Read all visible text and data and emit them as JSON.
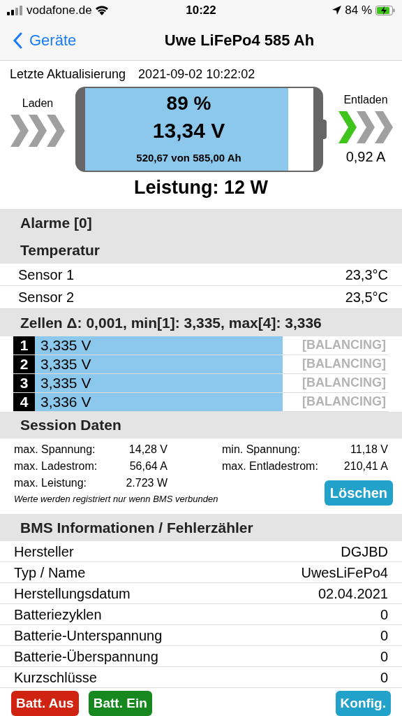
{
  "status_bar": {
    "carrier": "vodafone.de",
    "time": "10:22",
    "battery": "84 %"
  },
  "nav": {
    "back": "Geräte",
    "title": "Uwe LiFePo4 585 Ah"
  },
  "update": {
    "label": "Letzte Aktualisierung",
    "value": "2021-09-02 10:22:02"
  },
  "battery": {
    "percent": "89 %",
    "voltage": "13,34 V",
    "capacity": "520,67 von 585,00 Ah",
    "level": 0.89,
    "power": "Leistung: 12 W",
    "charge": {
      "label": "Laden",
      "arrows": [
        {
          "on": false
        },
        {
          "on": false
        },
        {
          "on": false
        }
      ]
    },
    "discharge": {
      "label": "Entladen",
      "current": "0,92 A",
      "arrows": [
        {
          "on": true
        },
        {
          "on": false
        },
        {
          "on": false
        }
      ]
    }
  },
  "alarms": {
    "title": "Alarme [0]"
  },
  "temperature": {
    "title": "Temperatur",
    "sensors": [
      {
        "name": "Sensor 1",
        "value": "23,3°C"
      },
      {
        "name": "Sensor 2",
        "value": "23,5°C"
      }
    ]
  },
  "cells": {
    "title": "Zellen Δ: 0,001, min[1]: 3,335, max[4]: 3,336",
    "items": [
      {
        "index": "1",
        "voltage": "3,335 V",
        "balancing": false,
        "status": "[BALANCING]"
      },
      {
        "index": "2",
        "voltage": "3,335 V",
        "balancing": false,
        "status": "[BALANCING]"
      },
      {
        "index": "3",
        "voltage": "3,335 V",
        "balancing": false,
        "status": "[BALANCING]"
      },
      {
        "index": "4",
        "voltage": "3,336 V",
        "balancing": false,
        "status": "[BALANCING]"
      }
    ]
  },
  "session": {
    "title": "Session Daten",
    "left": [
      {
        "label": "max. Spannung:",
        "value": "14,28 V"
      },
      {
        "label": "max. Ladestrom:",
        "value": "56,64 A"
      },
      {
        "label": "max. Leistung:",
        "value": "2.723 W"
      }
    ],
    "right": [
      {
        "label": "min. Spannung:",
        "value": "11,18 V"
      },
      {
        "label": "max. Entladestrom:",
        "value": "210,41 A"
      }
    ],
    "note": "Werte werden registriert nur wenn BMS verbunden",
    "clear_button": "Löschen"
  },
  "bms": {
    "title": "BMS Informationen / Fehlerzähler",
    "rows": [
      {
        "label": "Hersteller",
        "value": "DGJBD"
      },
      {
        "label": "Typ / Name",
        "value": "UwesLiFePo4"
      },
      {
        "label": "Herstellungsdatum",
        "value": "02.04.2021"
      },
      {
        "label": "Batteriezyklen",
        "value": "0"
      },
      {
        "label": "Batterie-Unterspannung",
        "value": "0"
      },
      {
        "label": "Batterie-Überspannung",
        "value": "0"
      },
      {
        "label": "Kurzschlüsse",
        "value": "0"
      }
    ]
  },
  "buttons": [
    {
      "label": "Batt. Aus",
      "kind": "danger"
    },
    {
      "label": "Batt. Ein",
      "kind": "success"
    },
    {
      "label": "Konfig.",
      "kind": "info"
    }
  ]
}
